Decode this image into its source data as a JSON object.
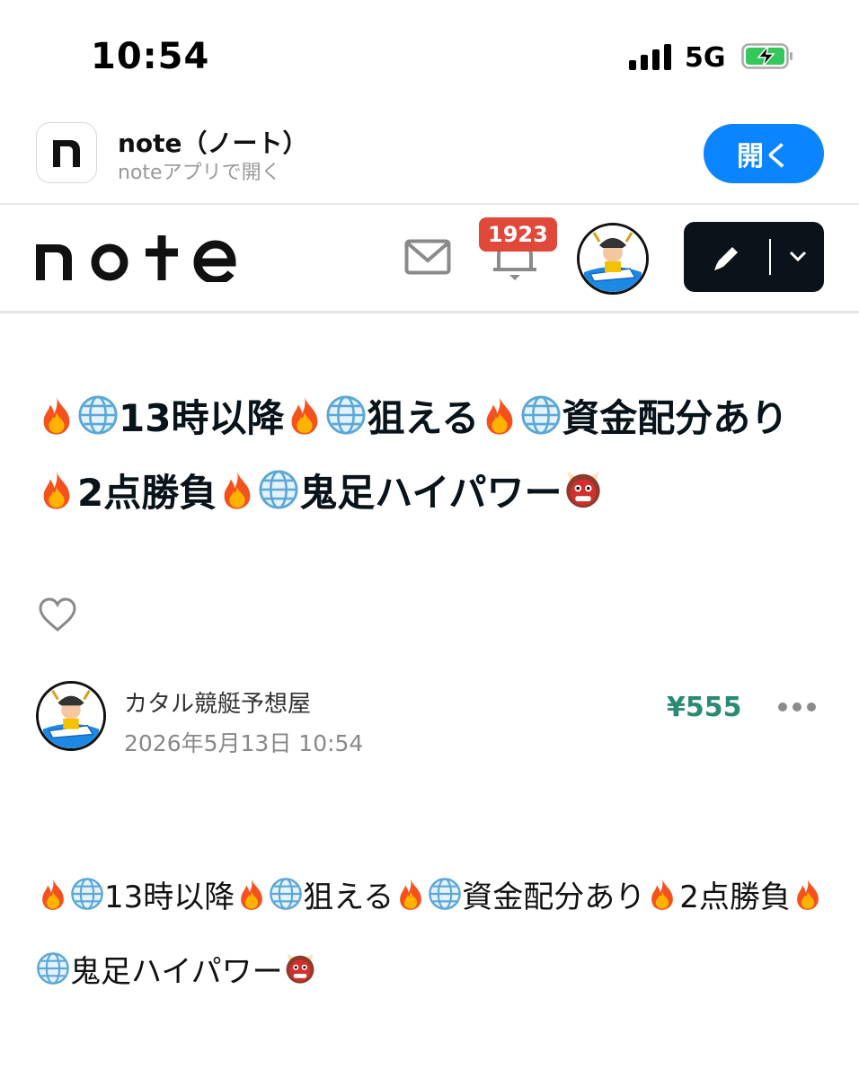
{
  "status_bar": {
    "time": "10:54",
    "network": "5G",
    "icons": [
      "signal-bars-icon",
      "battery-charging-icon"
    ]
  },
  "app_banner": {
    "app_name": "note（ノート）",
    "subtitle": "noteアプリで開く",
    "open_label": "開く",
    "icon": "note-app-icon"
  },
  "header": {
    "logo_alt": "note",
    "notification_count": "1923",
    "icons": [
      "mail-icon",
      "bell-icon",
      "pencil-icon",
      "chevron-down-icon"
    ]
  },
  "article": {
    "title_segments": [
      "🔥",
      "🌐",
      "13時以降",
      "🔥",
      "🌐",
      "狙える",
      "🔥",
      "🌐",
      "資金配分あり",
      "🔥",
      "2点勝負",
      "🔥",
      "🌐",
      "鬼足ハイパワー",
      "👹"
    ],
    "title_text": "🔥🌐13時以降🔥🌐狙える🔥🌐資金配分あり🔥2点勝負🔥🌐鬼足ハイパワー👹",
    "author": "カタル競艇予想屋",
    "date": "2026年5月13日 10:54",
    "price": "¥555",
    "body_text": "🔥🌐13時以降🔥🌐狙える🔥🌐資金配分あり🔥2点勝負🔥🌐鬼足ハイパワー👹"
  },
  "colors": {
    "accent_blue": "#0a84ff",
    "price_green": "#2a8a73",
    "badge_red": "#e0483a",
    "dark": "#0b1219"
  }
}
